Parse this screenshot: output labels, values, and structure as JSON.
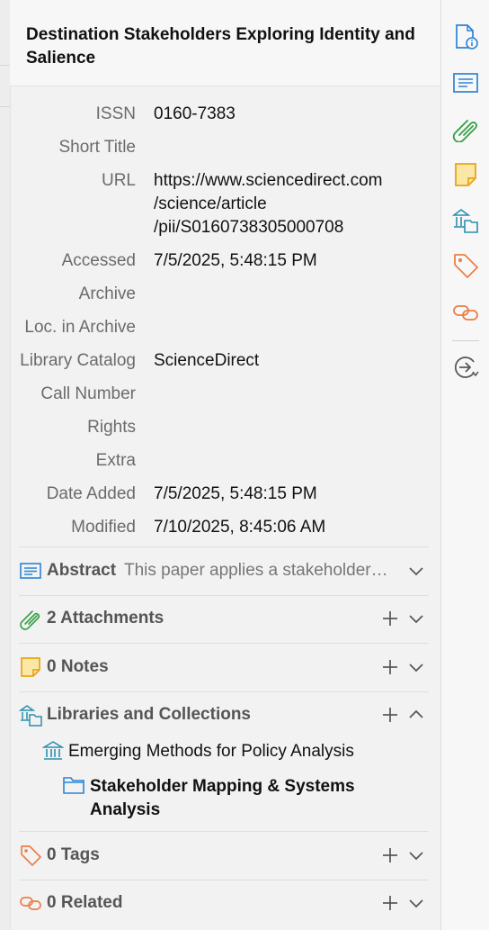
{
  "item": {
    "title": "Destination Stakeholders Exploring Identity and Salience"
  },
  "fields": [
    {
      "label": "ISSN",
      "value": "0160-7383"
    },
    {
      "label": "Short Title",
      "value": ""
    },
    {
      "label": "URL",
      "value_lines": [
        "https://www.sciencedirect.com",
        "/science/article",
        "/pii/S0160738305000708"
      ]
    },
    {
      "label": "Accessed",
      "value": "7/5/2025, 5:48:15 PM"
    },
    {
      "label": "Archive",
      "value": ""
    },
    {
      "label": "Loc. in Archive",
      "value": ""
    },
    {
      "label": "Library Catalog",
      "value": "ScienceDirect"
    },
    {
      "label": "Call Number",
      "value": ""
    },
    {
      "label": "Rights",
      "value": ""
    },
    {
      "label": "Extra",
      "value": ""
    },
    {
      "label": "Date Added",
      "value": "7/5/2025, 5:48:15 PM"
    },
    {
      "label": "Modified",
      "value": "7/10/2025, 8:45:06 AM"
    }
  ],
  "sections": {
    "abstract": {
      "label": "Abstract",
      "summary": "This paper applies a stakeholder…"
    },
    "attachments": {
      "label": "2 Attachments"
    },
    "notes": {
      "label": "0 Notes"
    },
    "libraries": {
      "label": "Libraries and Collections"
    },
    "tags": {
      "label": "0 Tags"
    },
    "related": {
      "label": "0 Related"
    }
  },
  "libraries": {
    "library_name": "Emerging Methods for Policy Analysis",
    "collection_lines": [
      "Stakeholder Mapping & Systems",
      "Analysis"
    ]
  },
  "sidenav_icons": [
    "info-icon",
    "abstract-icon",
    "attachments-icon",
    "notes-icon",
    "libraries-collections-icon",
    "tags-icon",
    "related-icon",
    "locate-icon"
  ],
  "colors": {
    "blue": "#2b84d6",
    "green": "#3aa149",
    "yellow": "#e6a614",
    "orange": "#ea7f4a",
    "teal": "#2a8fae"
  }
}
